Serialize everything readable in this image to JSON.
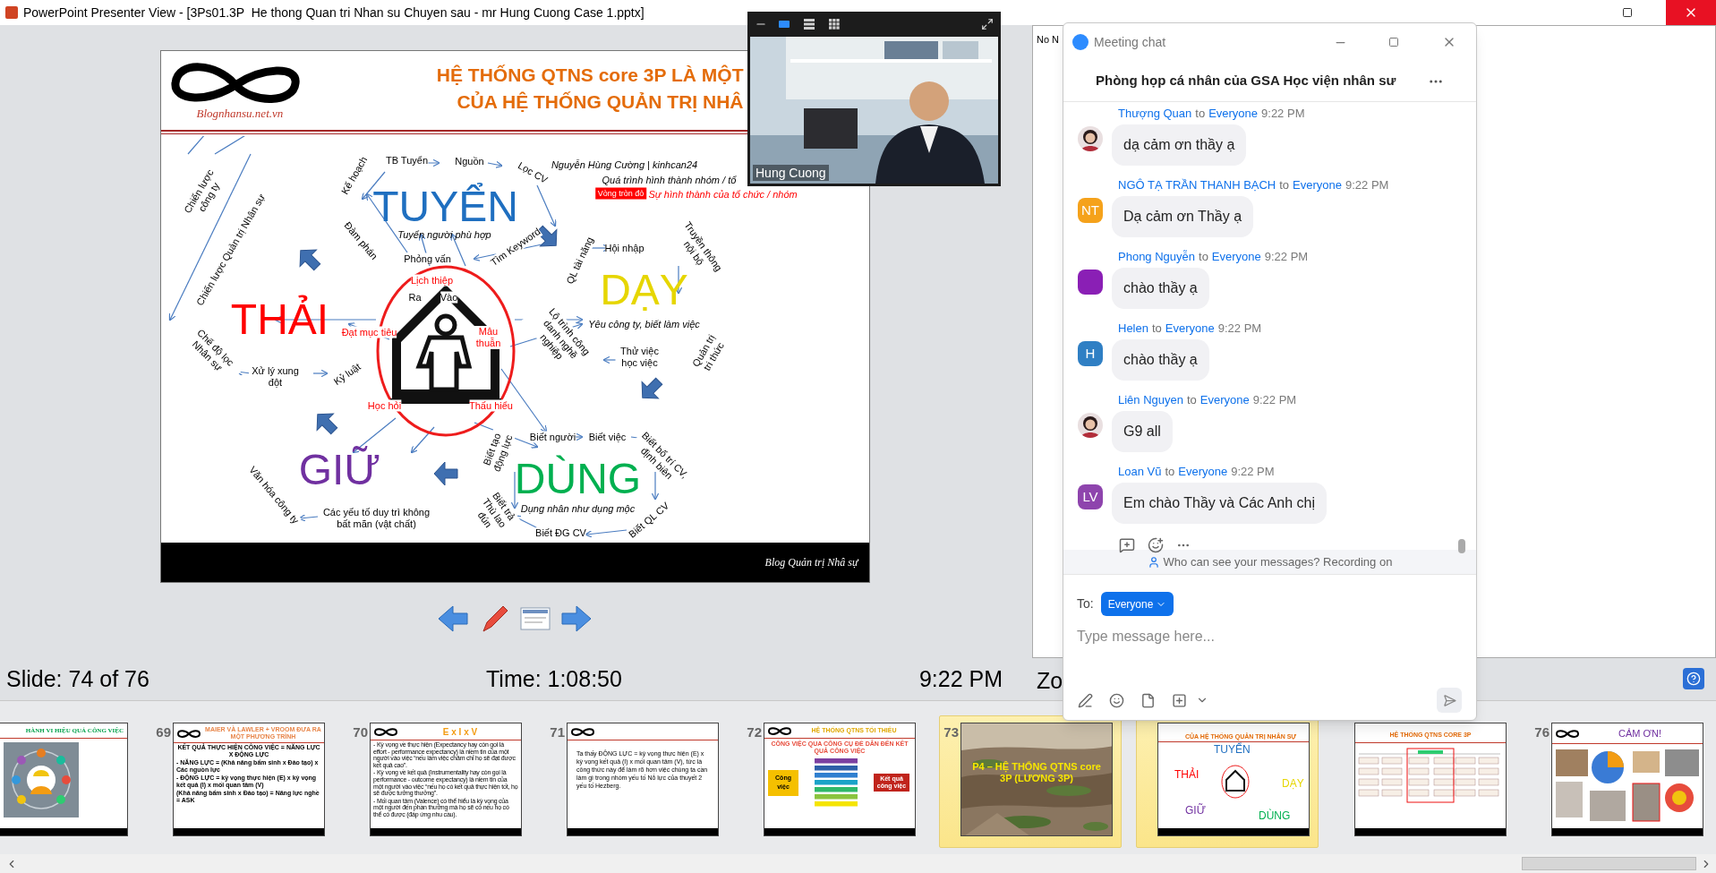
{
  "window": {
    "title": "PowerPoint Presenter View - [3Ps01.3P  He thong Quan tri Nhan su Chuyen sau - mr Hung Cuong Case 1.pptx]"
  },
  "slide": {
    "logo_text": "Blognhansu.net.vn",
    "title_lines": [
      "HỆ THỐNG QTNS core 3P LÀ MỘT",
      "CỦA HỆ THỐNG QUẢN TRỊ NHÂ"
    ],
    "labels": [
      {
        "text": "Chiến lược công ty",
        "kind": "note"
      },
      {
        "text": "Kế hoạch",
        "kind": "note"
      },
      {
        "text": "TB Tuyển",
        "kind": "note"
      },
      {
        "text": "Nguồn",
        "kind": "note"
      },
      {
        "text": "Lọc CV",
        "kind": "note"
      },
      {
        "text": "Nguyễn Hùng Cường | kinhcan24",
        "kind": "italic_note"
      },
      {
        "text": "Quá trình hình thành nhóm / tổ",
        "kind": "italic_note"
      },
      {
        "text": "Vòng tròn đỏ",
        "kind": "tag"
      },
      {
        "text": "Sự hình thành của tổ chức / nhóm",
        "kind": "red_italic_note"
      },
      {
        "text": "Chiến lược Quản trị Nhân sự",
        "kind": "note"
      },
      {
        "text": "Đàm phán",
        "kind": "note"
      },
      {
        "text": "TUYỂN",
        "kind": "topic",
        "color": "#1f6fc0"
      },
      {
        "text": "Tuyển người phù hợp",
        "kind": "italic_note"
      },
      {
        "text": "Phỏng vấn",
        "kind": "note"
      },
      {
        "text": "Tìm Keyword",
        "kind": "note"
      },
      {
        "text": "QL tài năng",
        "kind": "note"
      },
      {
        "text": "Hội nhập",
        "kind": "note"
      },
      {
        "text": "Truyền thông nội bộ",
        "kind": "note"
      },
      {
        "text": "Lịch thiệp",
        "kind": "red_note"
      },
      {
        "text": "Chế độ lọc Nhân sự",
        "kind": "note"
      },
      {
        "text": "THẢI",
        "kind": "topic",
        "color": "#ff0000"
      },
      {
        "text": "Ra",
        "kind": "note"
      },
      {
        "text": "Vào",
        "kind": "note"
      },
      {
        "text": "DẠY",
        "kind": "topic",
        "color": "#e6d600"
      },
      {
        "text": "Đạt mục tiêu",
        "kind": "red_note"
      },
      {
        "text": "Mâu thuẫn",
        "kind": "red_note"
      },
      {
        "text": "Lộ trình công danh nghề nghiệp",
        "kind": "note"
      },
      {
        "text": "Yêu công ty, biết làm việc",
        "kind": "italic_note"
      },
      {
        "text": "Thử việc học việc",
        "kind": "note"
      },
      {
        "text": "Quản trị tri thức",
        "kind": "note"
      },
      {
        "text": "Xử lý xung đột",
        "kind": "note"
      },
      {
        "text": "Kỷ luật",
        "kind": "note"
      },
      {
        "text": "Học hỏi",
        "kind": "red_note"
      },
      {
        "text": "Thấu hiểu",
        "kind": "red_note"
      },
      {
        "text": "Biết người",
        "kind": "note"
      },
      {
        "text": "Biết việc",
        "kind": "note"
      },
      {
        "text": "Văn hóa công ty",
        "kind": "note"
      },
      {
        "text": "GIỮ",
        "kind": "topic",
        "color": "#7030a0"
      },
      {
        "text": "Biết tạo động lực",
        "kind": "note"
      },
      {
        "text": "DÙNG",
        "kind": "topic",
        "color": "#00b050"
      },
      {
        "text": "Biết bố trí CV, định biên",
        "kind": "note"
      },
      {
        "text": "Các yếu tố duy trì không bất mãn (vật chất)",
        "kind": "note"
      },
      {
        "text": "Biết trả Thù lao đún",
        "kind": "note"
      },
      {
        "text": "Dụng nhân như dụng mộc",
        "kind": "italic_note"
      },
      {
        "text": "Biết ĐG CV",
        "kind": "note"
      },
      {
        "text": "Biết QL CV",
        "kind": "note"
      }
    ],
    "footer": "Blog Quản trị Nhâ sự"
  },
  "video": {
    "view_buttons": [
      {
        "kind": "speaker",
        "selected": true
      },
      {
        "kind": "strip",
        "selected": false
      },
      {
        "kind": "grid",
        "selected": false
      }
    ],
    "name": "Hung Cuong"
  },
  "notes": {
    "text": "No N",
    "zoom_label": "Zo"
  },
  "status": {
    "slide": "Slide: 74 of 76",
    "time": "Time: 1:08:50",
    "clock": "9:22 PM"
  },
  "chat": {
    "window_title": "Meeting chat",
    "room": "Phòng họp cá nhân của GSA Học viện nhân sư",
    "messages": [
      {
        "sender": "Thượng Quan",
        "to": "to",
        "recipient": "Everyone",
        "time": "9:22 PM",
        "text": "dạ cảm ơn thầy ạ"
      },
      {
        "sender": "NGÔ TẠ TRẦN THANH BẠCH",
        "to": "to",
        "recipient": "Everyone",
        "time": "9:22 PM",
        "text": "Dạ cảm ơn Thầy ạ",
        "avatar": {
          "kind": "initials",
          "initials": "NT",
          "color": "#f5a21b"
        }
      },
      {
        "sender": "Phong Nguyễn",
        "to": "to",
        "recipient": "Everyone",
        "time": "9:22 PM",
        "text": "chào thầy ạ",
        "avatar": {
          "kind": "plain",
          "color": "#8a1fb5"
        }
      },
      {
        "sender": "Helen",
        "to": "to",
        "recipient": "Everyone",
        "time": "9:22 PM",
        "text": "chào thầy ạ",
        "avatar": {
          "kind": "initials",
          "initials": "H",
          "color": "#2f7fc4"
        }
      },
      {
        "sender": "Liên Nguyen",
        "to": "to",
        "recipient": "Everyone",
        "time": "9:22 PM",
        "text": "G9 all"
      },
      {
        "sender": "Loan Vũ",
        "to": "to",
        "recipient": "Everyone",
        "time": "9:22 PM",
        "text": "Em chào Thầy và Các Anh chị",
        "avatar": {
          "kind": "initials",
          "initials": "LV",
          "color": "#8e44ad"
        }
      }
    ],
    "notice": "Who can see your messages? Recording on",
    "to_label": "To:",
    "to_value": "Everyone",
    "placeholder": "Type message here..."
  },
  "thumbs": [
    {
      "selected": false,
      "kind": "picture_slide",
      "title": "HÀNH VI HIỆU QUẢ CÔNG VIỆC"
    },
    {
      "number": "69",
      "selected": false,
      "kind": "text",
      "title": "MAIER VÀ LAWLER + VROOM ĐƯA RA MỘT PHƯƠNG TRÌNH",
      "heading": "KẾT QUẢ THỰC HIỆN CÔNG VIỆC = NĂNG LỰC X ĐỘNG LỰC",
      "body": [
        "- NĂNG LỰC = (Khả năng bẩm sinh x Đào tạo) x Các nguồn lực",
        "- ĐỘNG LỰC = kỳ vọng thực hiện (E) x kỳ vọng kết quả (I) x mối quan tâm (V)",
        "(Khả năng bẩm sinh x Đào tạo) = Năng lực nghề = ASK"
      ]
    },
    {
      "number": "70",
      "selected": false,
      "kind": "text",
      "title": "E x I x V",
      "body": [
        "- Kỳ vọng về thực hiện (Expectancy hay còn gọi là effort - performance expectancy) là niềm tin của một người vào việc “nếu làm việc chăm chỉ họ sẽ đạt được kết quả cao”.",
        "- Kỳ vọng về kết quả (Instrumentality hay còn gọi là performance - outcome expectancy) là niềm tin của một người vào việc “nếu họ có kết quả thực hiện tốt, họ sẽ được tưởng thưởng”.",
        "- Mối quan tâm (Valence) có thể hiểu là kỳ vọng của một người đến phần thưởng mà họ sẽ có nếu họ có thể có được (đáp ứng nhu cầu)."
      ]
    },
    {
      "number": "71",
      "selected": false,
      "kind": "text",
      "body": [
        "Ta thấy ĐỘNG LỰC = kỳ vọng thực hiện (E) x kỳ vọng kết quả (I) x mối quan tâm (V), tức là công thức này để làm rõ hơn việc chúng ta cần làm gì trong nhóm yếu tố Nỗ lực của thuyết 2 yếu tố Hezberg."
      ]
    },
    {
      "number": "72",
      "selected": false,
      "kind": "diagram",
      "title": "HỆ THỐNG QTNS TỐI THIỂU",
      "subtitle": "CÔNG VIỆC QUA CÔNG CỤ ĐỂ DẪN ĐẾN KẾT QUẢ CÔNG VIỆC",
      "left_box": "Công việc",
      "right_box": "Kết quả công việc"
    },
    {
      "number": "73",
      "selected": true,
      "title": "P4 – HỆ THỐNG QTNS core 3P (LƯƠNG 3P)"
    },
    {
      "selected": true,
      "kind": "mindmap",
      "title": "CỦA HỆ THỐNG QUẢN TRỊ NHÂN SỰ",
      "words": [
        {
          "text": "TUYỂN",
          "color": "#1f6fc0"
        },
        {
          "text": "THẢI",
          "color": "#ff0000"
        },
        {
          "text": "DẠY",
          "color": "#e6d600"
        },
        {
          "text": "GIỮ",
          "color": "#7030a0"
        },
        {
          "text": "DÙNG",
          "color": "#00b050"
        }
      ]
    },
    {
      "selected": false,
      "kind": "chart",
      "title": "HỆ THỐNG QTNS CORE 3P"
    },
    {
      "number": "76",
      "selected": false,
      "kind": "collage",
      "title": "CẢM ƠN!"
    }
  ]
}
